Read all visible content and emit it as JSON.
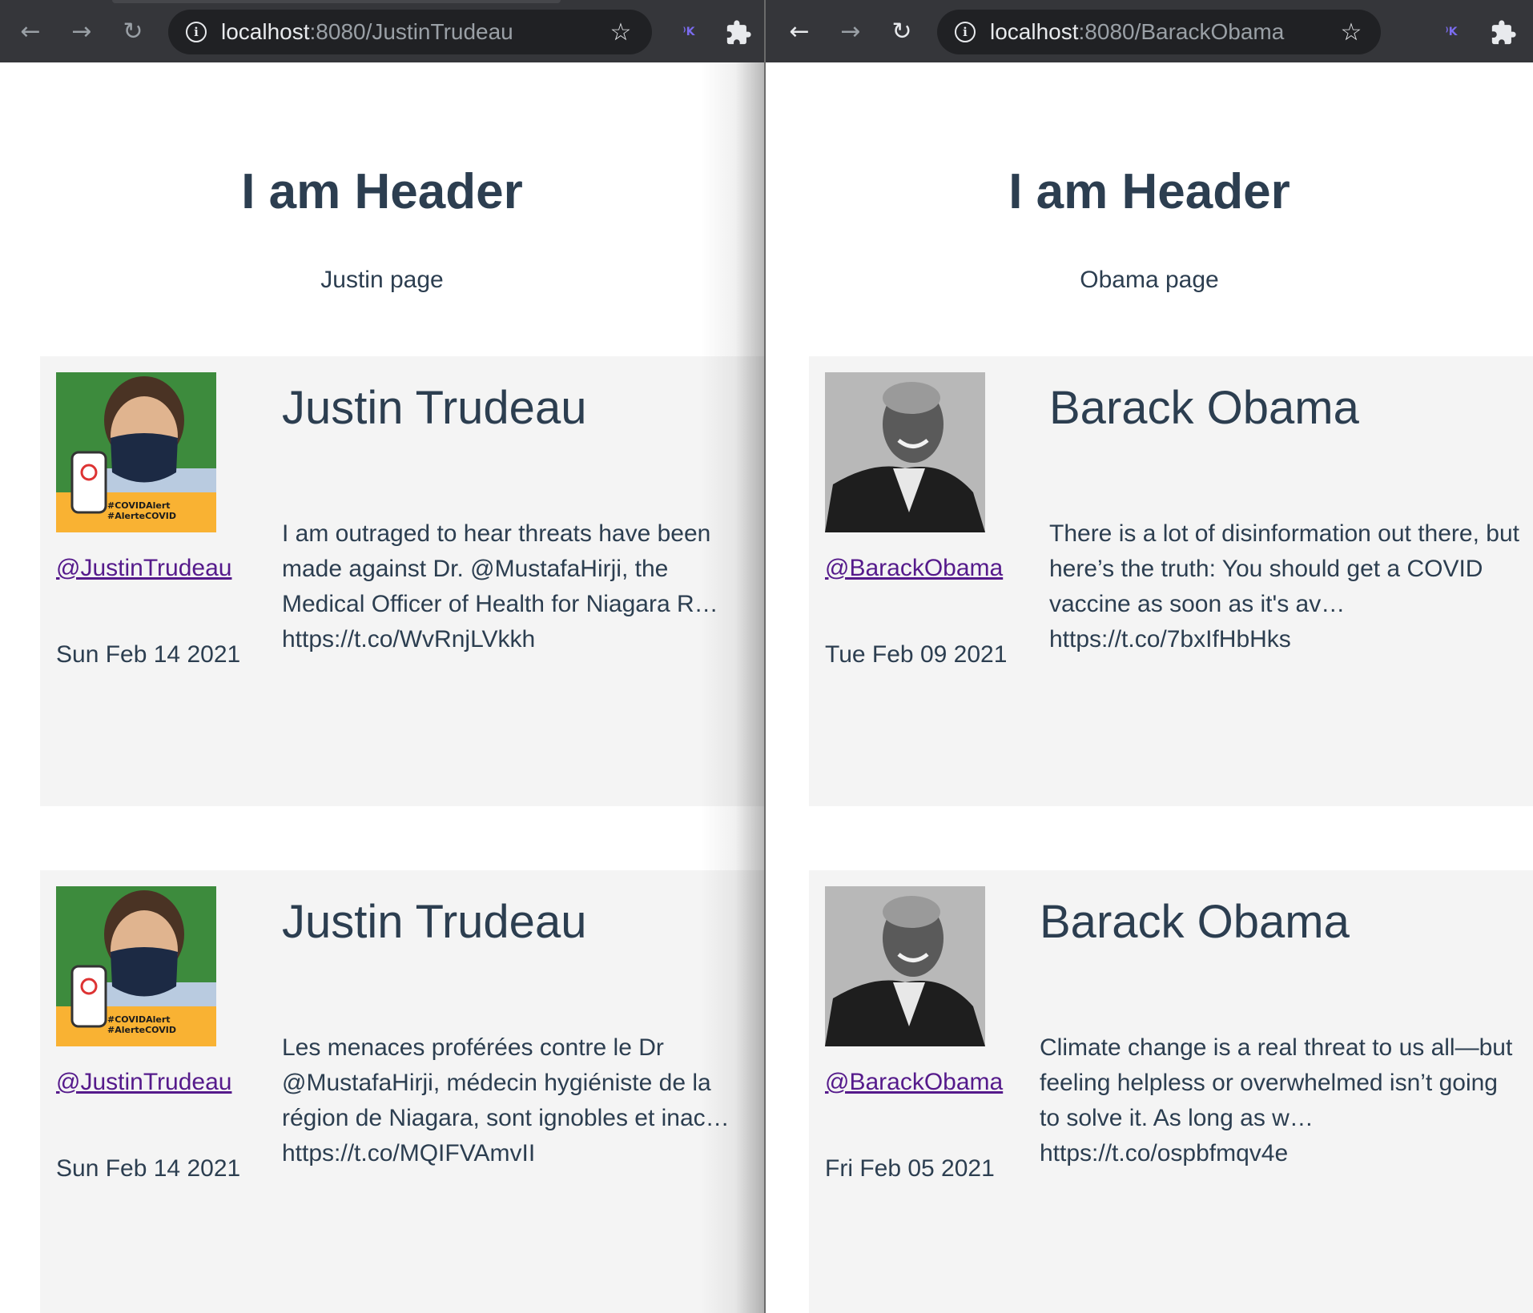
{
  "windows": [
    {
      "url_host": "localhost",
      "url_rest": ":8080/JustinTrudeau",
      "header": "I am Header",
      "subtitle": "Justin page",
      "cards": [
        {
          "name": "Justin Trudeau",
          "handle": "@JustinTrudeau",
          "date": "Sun Feb 14 2021",
          "tweet": "I am outraged to hear threats have been made against Dr. @MustafaHirji, the Medical Officer of Health for Niagara R… https://t.co/WvRnjLVkkh",
          "avatar_caption_1": "#COVIDAlert",
          "avatar_caption_2": "#AlerteCOVID"
        },
        {
          "name": "Justin Trudeau",
          "handle": "@JustinTrudeau",
          "date": "Sun Feb 14 2021",
          "tweet": "Les menaces proférées contre le Dr @MustafaHirji, médecin hygiéniste de la région de Niagara, sont ignobles et inac… https://t.co/MQIFVAmvII",
          "avatar_caption_1": "#COVIDAlert",
          "avatar_caption_2": "#AlerteCOVID"
        }
      ]
    },
    {
      "url_host": "localhost",
      "url_rest": ":8080/BarackObama",
      "header": "I am Header",
      "subtitle": "Obama page",
      "cards": [
        {
          "name": "Barack Obama",
          "handle": "@BarackObama",
          "date": "Tue Feb 09 2021",
          "tweet": "There is a lot of disinformation out there, but here’s the truth: You should get a COVID vaccine as soon as it's av… https://t.co/7bxIfHbHks"
        },
        {
          "name": "Barack Obama",
          "handle": "@BarackObama",
          "date": "Fri Feb 05 2021",
          "tweet": "Climate change is a real threat to us all—but feeling helpless or overwhelmed isn’t going to solve it. As long as w… https://t.co/ospbfmqv4e"
        }
      ]
    }
  ],
  "icons": {
    "back": "arrow-back-icon",
    "forward": "arrow-forward-icon",
    "reload": "reload-icon",
    "info": "info-icon",
    "star": "bookmark-star-icon",
    "extension": "extension-icon",
    "extensions_menu": "puzzle-icon"
  },
  "colors": {
    "toolbar": "#35363a",
    "omnibox": "#202124",
    "text": "#2c3e50",
    "link": "#551a8b",
    "card_bg": "#f4f4f4",
    "trudeau_bg": "#3d8b3d",
    "trudeau_banner": "#f9b233"
  }
}
